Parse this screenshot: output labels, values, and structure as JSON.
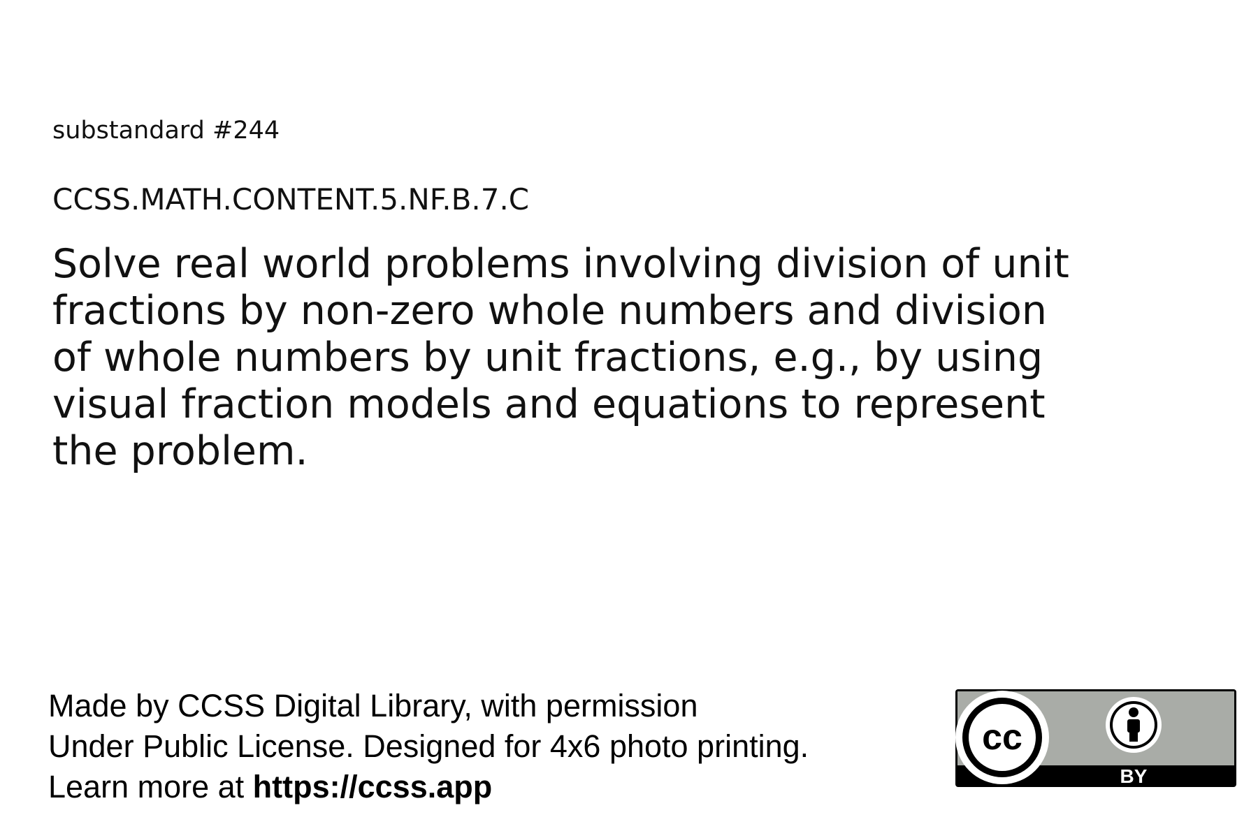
{
  "card": {
    "substandard_label": "substandard #244",
    "standard_code": "CCSS.MATH.CONTENT.5.NF.B.7.C",
    "description": "Solve real world problems involving division of unit fractions by non-zero whole numbers and division of whole numbers by unit fractions, e.g., by using visual fraction models and equations to represent the problem."
  },
  "footer": {
    "line1": "Made by CCSS Digital Library, with permission",
    "line2": "Under Public License. Designed for 4x6 photo printing.",
    "line3_prefix": "Learn more at ",
    "line3_link": "https://ccss.app"
  },
  "license_badge": {
    "cc_text": "cc",
    "by_text": "BY",
    "icons": [
      "cc-logo-icon",
      "attribution-person-icon"
    ],
    "colors": {
      "badge_gray": "#a9aca7",
      "badge_black": "#000000",
      "badge_white": "#ffffff"
    }
  }
}
